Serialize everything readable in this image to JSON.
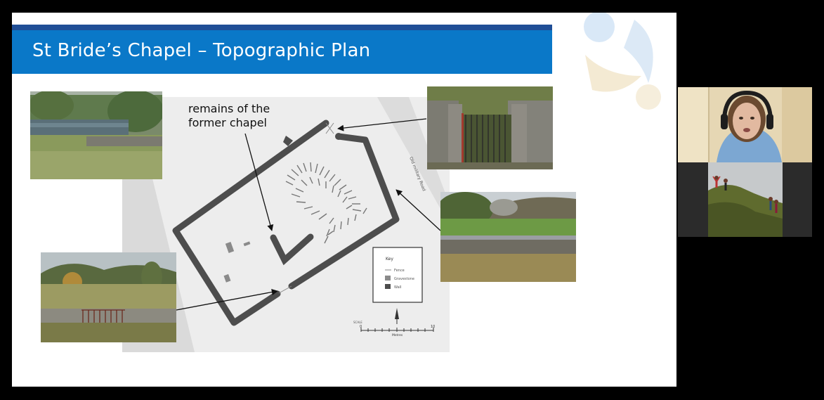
{
  "slide": {
    "title": "St Bride’s Chapel – Topographic Plan",
    "annotation_line1": "remains of the",
    "annotation_line2": "former chapel"
  },
  "plan": {
    "road_label": "Old military Road",
    "key_title": "Key",
    "key_items": [
      "Fence",
      "Gravestone",
      "Wall"
    ],
    "scale_label": "SCALE",
    "scale_start": "0",
    "scale_end": "10",
    "scale_unit": "Metres"
  },
  "participants": [
    {
      "name": "",
      "role": "presenter",
      "icon": "headset-person"
    },
    {
      "name": "",
      "role": "participant",
      "icon": "hill-group-photo"
    }
  ],
  "colors": {
    "title_bar": "#0a78c8",
    "title_strip": "#1f4e96",
    "wall": "#4d4d4d",
    "plan_bg": "#ededed"
  }
}
